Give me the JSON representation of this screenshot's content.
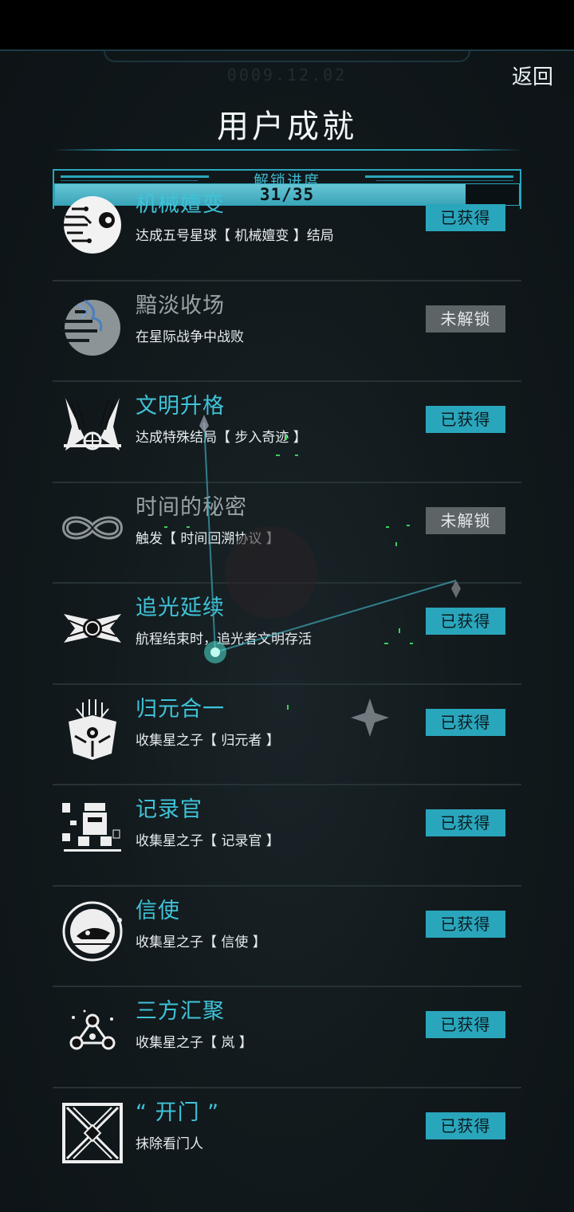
{
  "header": {
    "date": "0009.12.02",
    "back_label": "返回",
    "title": "用户成就"
  },
  "progress": {
    "label": "解锁进度",
    "text": "31/35",
    "unlocked": 31,
    "total": 35
  },
  "colors": {
    "accent": "#2aa6bc",
    "earned_text": "#3fc3d8",
    "locked_badge": "#5d6466"
  },
  "achievements": [
    {
      "name": "机械嬗变",
      "desc": "达成五号星球【 机械嬗变 】结局",
      "status": "已获得",
      "earned": true,
      "icon": "eyeball-machine-icon"
    },
    {
      "name": "黯淡收场",
      "desc": "在星际战争中战败",
      "status": "未解锁",
      "earned": false,
      "icon": "cracked-planet-icon"
    },
    {
      "name": "文明升格",
      "desc": "达成特殊结局【 步入奇迹 】",
      "status": "已获得",
      "earned": true,
      "icon": "winged-globe-icon"
    },
    {
      "name": "时间的秘密",
      "desc": "触发【 时间回溯协议 】",
      "status": "未解锁",
      "earned": false,
      "icon": "infinity-icon"
    },
    {
      "name": "追光延续",
      "desc": "航程结束时，追光者文明存活",
      "status": "已获得",
      "earned": true,
      "icon": "winged-ship-icon"
    },
    {
      "name": "归元合一",
      "desc": "收集星之子【 归元者 】",
      "status": "已获得",
      "earned": true,
      "icon": "robot-mask-icon"
    },
    {
      "name": "记录官",
      "desc": "收集星之子【 记录官 】",
      "status": "已获得",
      "earned": true,
      "icon": "pixel-robot-icon"
    },
    {
      "name": "信使",
      "desc": "收集星之子【 信使 】",
      "status": "已获得",
      "earned": true,
      "icon": "orbit-ship-icon"
    },
    {
      "name": "三方汇聚",
      "desc": "收集星之子【 岚 】",
      "status": "已获得",
      "earned": true,
      "icon": "triad-nodes-icon"
    },
    {
      "name": "“ 开门 ”",
      "desc": "抹除看门人",
      "status": "已获得",
      "earned": true,
      "icon": "hourglass-gate-icon"
    }
  ]
}
